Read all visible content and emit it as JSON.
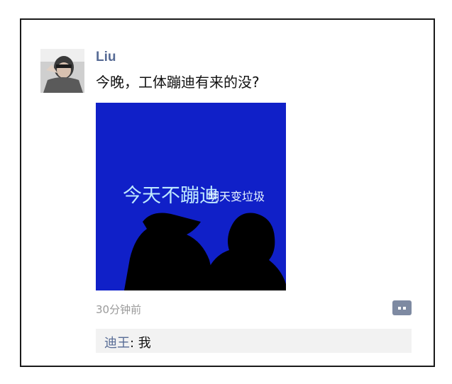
{
  "post": {
    "username": "Liu",
    "text": "今晚，工体蹦迪有来的没?",
    "image": {
      "caption_main": "今天不蹦迪",
      "caption_sub": "明天变垃圾",
      "background_color": "#1020c8"
    },
    "timestamp": "30分钟前"
  },
  "actions": {
    "comment_icon": "comment-bubble-icon",
    "accent_color": "#7e8aa2"
  },
  "comments": [
    {
      "author": "迪王",
      "separator": ": ",
      "text": "我"
    }
  ]
}
